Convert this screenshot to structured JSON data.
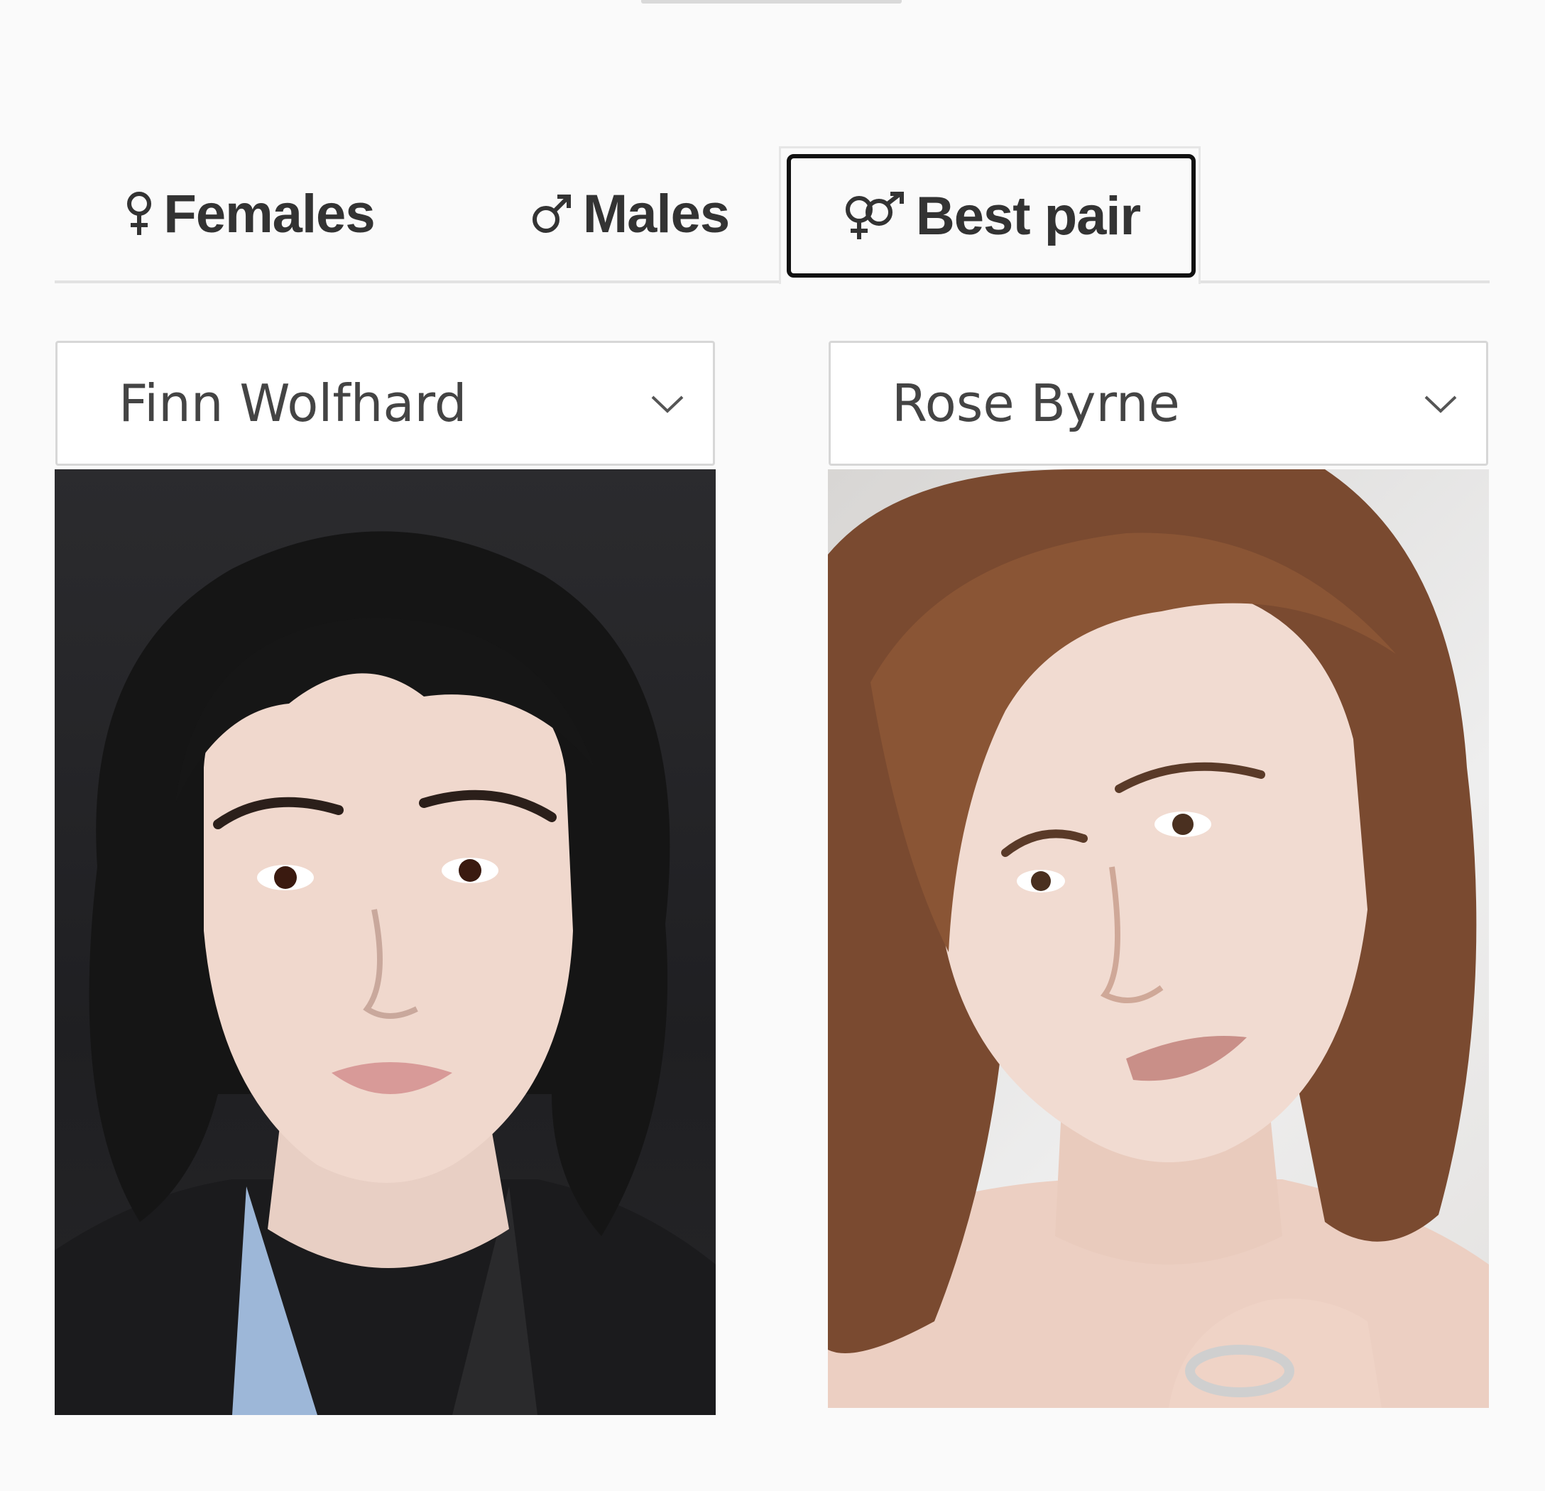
{
  "tabs": [
    {
      "label": "Females",
      "symbol": "♀",
      "icon": "female-icon"
    },
    {
      "label": "Males",
      "symbol": "♂",
      "icon": "male-icon"
    },
    {
      "label": "Best pair",
      "symbol": "⚤",
      "icon": "couple-icon",
      "selected": true
    }
  ],
  "left_select": {
    "value": "Finn Wolfhard"
  },
  "right_select": {
    "value": "Rose Byrne"
  },
  "colors": {
    "background": "#fafafa",
    "text": "#333333",
    "select_text": "#444444",
    "selected_border": "#111111"
  }
}
